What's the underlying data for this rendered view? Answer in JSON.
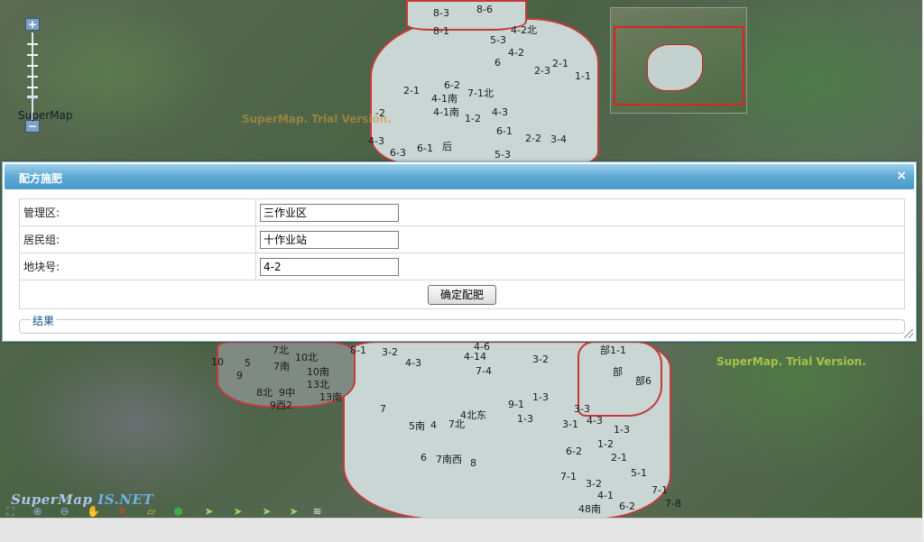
{
  "map": {
    "scale_label": "SuperMap",
    "watermark_1": "SuperMap. Trial Version.",
    "watermark_2": "SuperMap. Trial Version.",
    "logo_text": "SuperMap",
    "logo_net": "IS.NET",
    "labels_top": [
      "8-3",
      "8-6",
      "8-1",
      "5-3",
      "4-2北",
      "6",
      "4-2",
      "2-3",
      "2-1",
      "2-1",
      "6-2",
      "4-1南",
      "7-1北",
      "1-1",
      "4-1南",
      "4-3",
      "-2",
      "1-2",
      "4-3",
      "6-1",
      "后",
      "2-2",
      "3-4",
      "6-3",
      "6-1",
      "5-3"
    ],
    "labels_bottom": [
      "7北",
      "10北",
      "10",
      "5",
      "8-1",
      "3-2",
      "4-3",
      "4-14",
      "4-6",
      "7-4",
      "3-2",
      "9",
      "7南",
      "10南",
      "8北",
      "9中",
      "13北",
      "13南",
      "9西2",
      "7",
      "5南",
      "4",
      "7北",
      "4北东",
      "9-1",
      "1-3",
      "1-3",
      "3-1",
      "4-3",
      "3-3",
      "1-3",
      "6-2",
      "1-2",
      "2-1",
      "5-1",
      "7-1",
      "3-2",
      "4-1",
      "7-1",
      "6",
      "7南西",
      "8",
      "48南",
      "6-2",
      "7-8",
      "部1-1",
      "部",
      "部6"
    ]
  },
  "zoom": {
    "in_icon": "+",
    "out_icon": "−"
  },
  "dialog": {
    "title": "配方施肥",
    "close_glyph": "×",
    "fields": [
      {
        "label": "管理区:",
        "value": "三作业区"
      },
      {
        "label": "居民组:",
        "value": "十作业站"
      },
      {
        "label": "地块号:",
        "value": "4-2"
      }
    ],
    "confirm_label": "确定配肥",
    "result_legend": "结果"
  },
  "toolbar": {
    "icons": [
      "full-extent-icon",
      "zoom-in-icon",
      "zoom-out-icon",
      "pan-hand-icon",
      "clear-icon",
      "measure-distance-icon",
      "measure-area-icon",
      "select-point-icon",
      "select-line-icon",
      "select-rect-icon",
      "select-polygon-icon",
      "layers-icon"
    ],
    "colors": {
      "pan": "#d9d9d9",
      "clear": "#e04040",
      "measure": "#d8b84a",
      "area": "#3fae4a",
      "select": "#9fd36a",
      "layers": "#e8e8e8",
      "nav": "#88b8e0"
    }
  }
}
